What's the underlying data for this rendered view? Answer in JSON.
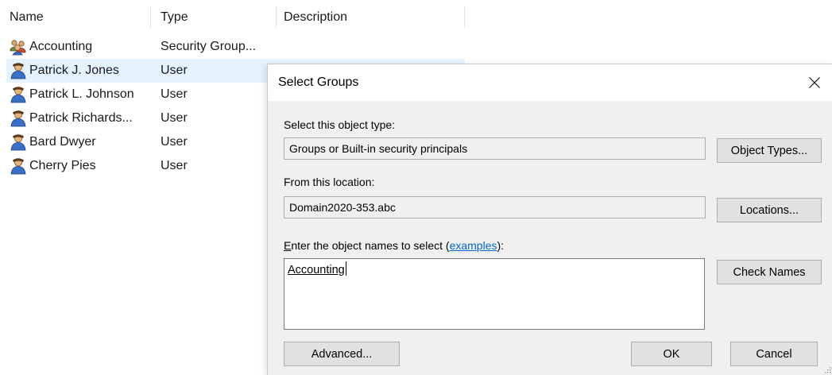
{
  "list": {
    "columns": {
      "name": "Name",
      "type": "Type",
      "description": "Description"
    },
    "rows": [
      {
        "name": "Accounting",
        "type": "Security Group...",
        "icon": "group-icon",
        "selected": false
      },
      {
        "name": "Patrick J. Jones",
        "type": "User",
        "icon": "user-icon",
        "selected": true
      },
      {
        "name": "Patrick L. Johnson",
        "type": "User",
        "icon": "user-icon",
        "selected": false
      },
      {
        "name": "Patrick Richards...",
        "type": "User",
        "icon": "user-icon",
        "selected": false
      },
      {
        "name": "Bard Dwyer",
        "type": "User",
        "icon": "user-icon",
        "selected": false
      },
      {
        "name": "Cherry Pies",
        "type": "User",
        "icon": "user-icon",
        "selected": false
      }
    ]
  },
  "dialog": {
    "title": "Select Groups",
    "object_type_label": "Select this object type:",
    "object_type_value": "Groups or Built-in security principals",
    "object_types_button": "Object Types...",
    "location_label": "From this location:",
    "location_value": "Domain2020-353.abc",
    "locations_button": "Locations...",
    "names_label_mnemonic": "E",
    "names_label_rest": "nter the object names to select (",
    "names_label_link": "examples",
    "names_label_end": "):",
    "names_value": "Accounting",
    "check_names_button": "Check Names",
    "advanced_button": "Advanced...",
    "ok_button": "OK",
    "cancel_button": "Cancel"
  },
  "colors": {
    "selection": "#e5f3ff",
    "dialog_bg": "#f0f0f0",
    "link": "#0066cc",
    "button_bg": "#e1e1e1"
  }
}
